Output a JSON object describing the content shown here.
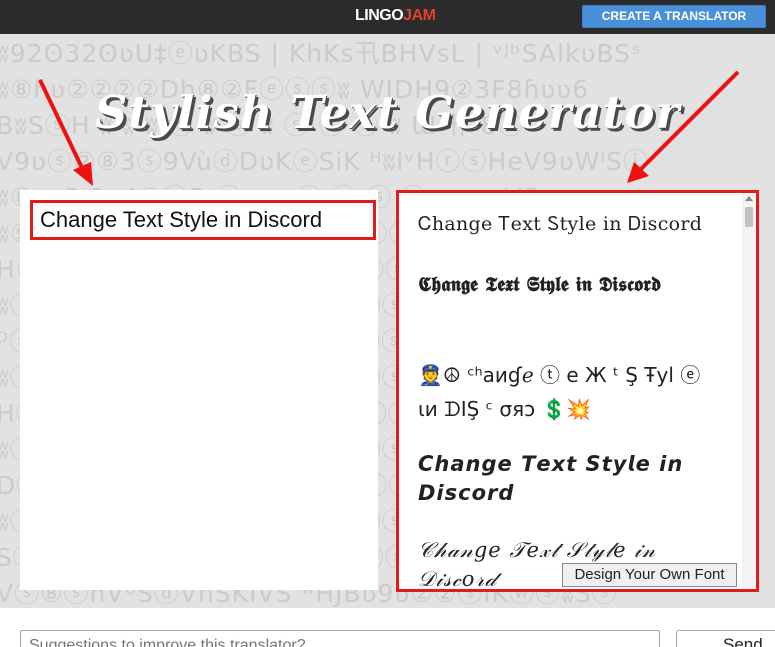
{
  "header": {
    "logo_part1": "LINGO",
    "logo_part2": "JAM",
    "create_translator_label": "CREATE A TRANSLATOR"
  },
  "hero": {
    "title": "Stylish Text Generator"
  },
  "input": {
    "value": "Change Text Style in Discord"
  },
  "output": {
    "items": [
      "Ꮯhange Ꭲext Ꮪtyle in Ꭰiscord",
      "𝕮𝖍𝖆𝖓𝖌𝖊 𝕿𝖊𝖝𝖙 𝕾𝖙𝖞𝖑𝖊 𝖎𝖓 𝕯𝖎𝖘𝖈𝖔𝖗𝖉",
      "👮☮ ᶜʰaͷɠℯ ⓣ е Ж ᵗ  Ş Ŧyl ⓔ ιи ᗪIŞ ᶜ σяↄ 💲💥",
      "𝘾𝙝𝙖𝙣𝙜𝙚 𝙏𝙚𝙭𝙩 𝙎𝙩𝙮𝙡𝙚 𝙞𝙣 𝘿𝙞𝙨𝙘𝙤𝙧𝙙",
      "𝒞𝒽𝒶𝓃𝑔𝑒 𝒯𝑒𝓍𝓉 𝒮𝓉𝓎𝓁𝑒 𝒾𝓃 𝒟𝒾𝓈𝒸𝑜𝓇𝒹"
    ],
    "design_button_label": "Design Your Own Font"
  },
  "feedback": {
    "placeholder": "Suggestions to improve this translator?",
    "send_label": "Send"
  },
  "colors": {
    "accent_red": "#e21b1b",
    "button_blue": "#4a90d9",
    "topbar": "#2b2b2b"
  }
}
